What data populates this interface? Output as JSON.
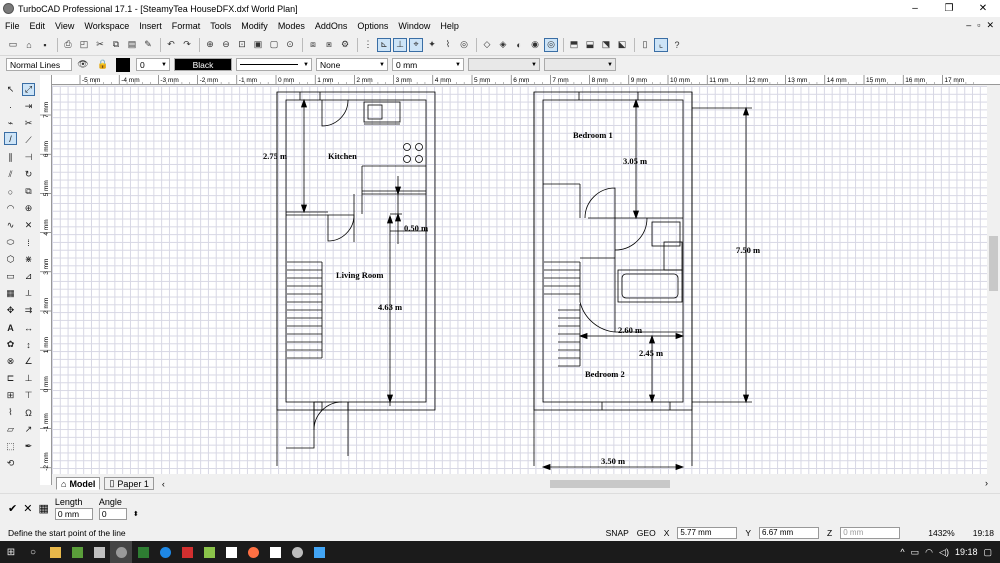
{
  "window": {
    "title": "TurboCAD Professional 17.1 - [SteamyTea HouseDFX.dxf World Plan]",
    "min": "–",
    "max": "❐",
    "close": "✕"
  },
  "menu": {
    "items": [
      "File",
      "Edit",
      "View",
      "Workspace",
      "Insert",
      "Format",
      "Tools",
      "Modify",
      "Modes",
      "AddOns",
      "Options",
      "Window",
      "Help"
    ],
    "doc_controls": [
      "–",
      "▫",
      "✕"
    ]
  },
  "property_bar": {
    "layer": "Normal Lines",
    "layer_count": "0",
    "color": "Black",
    "linestyle_end": "None",
    "width": "0 mm"
  },
  "ruler": {
    "h_labels": [
      "-5 mm",
      "-4 mm",
      "-3 mm",
      "-2 mm",
      "-1 mm",
      "0 mm",
      "1 mm",
      "2 mm",
      "3 mm",
      "4 mm",
      "5 mm",
      "6 mm",
      "7 mm",
      "8 mm",
      "9 mm",
      "10 mm",
      "11 mm",
      "12 mm",
      "13 mm",
      "14 mm",
      "15 mm",
      "16 mm",
      "17 mm"
    ],
    "v_labels": [
      "7 mm",
      "6 mm",
      "5 mm",
      "4 mm",
      "3 mm",
      "2 mm",
      "1 mm",
      "0 mm",
      "-1 mm",
      "-2 mm"
    ]
  },
  "drawing": {
    "kitchen_label": "Kitchen",
    "kitchen_dim": "2.75 m",
    "hall_dim": "0.50 m",
    "living_label": "Living Room",
    "living_dim": "4.63 m",
    "bed1_label": "Bedroom 1",
    "bed1_dim": "3.05 m",
    "total_dim": "7.50 m",
    "landing_dim": "2.60 m",
    "bed2_dim": "2.45 m",
    "bed2_label": "Bedroom 2",
    "width_dim": "3.50 m"
  },
  "tabs": {
    "model": "Model",
    "paper": "Paper 1"
  },
  "inspector": {
    "length_label": "Length",
    "length_value": "0 mm",
    "angle_label": "Angle",
    "angle_value": "0"
  },
  "status": {
    "prompt": "Define the start point of the line",
    "snap": "SNAP",
    "geo": "GEO",
    "x": "5.77 mm",
    "y": "6.67 mm",
    "z": "0 mm",
    "zoom": "1432%",
    "time": "19:18"
  },
  "taskbar": {
    "clock": "19:18"
  }
}
